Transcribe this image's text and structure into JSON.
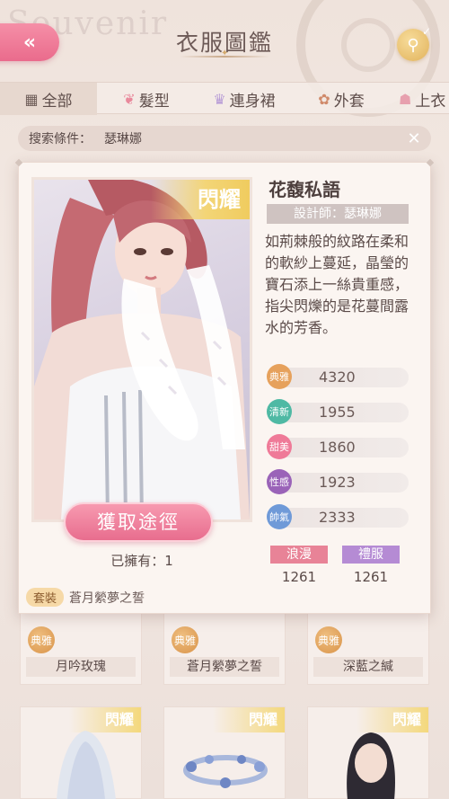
{
  "header": {
    "title": "衣服圖鑑",
    "back_icon": "double-chevron-left-icon",
    "search_icon": "magnifier-icon"
  },
  "background": {
    "ghost_text": "Souvenir"
  },
  "tabs": [
    {
      "label": "全部",
      "icon": "grid-icon",
      "active": true
    },
    {
      "label": "髮型",
      "icon": "hair-icon",
      "active": false
    },
    {
      "label": "連身裙",
      "icon": "dress-icon",
      "active": false
    },
    {
      "label": "外套",
      "icon": "coat-icon",
      "active": false
    },
    {
      "label": "上衣",
      "icon": "shirt-icon",
      "active": false
    }
  ],
  "filter": {
    "label": "搜索條件：",
    "value": "瑟琳娜"
  },
  "detail": {
    "name": "花馥私語",
    "designer": "設計師：瑟琳娜",
    "description": "如荊棘般的紋路在柔和的軟紗上蔓延，晶瑩的寶石添上一絲貴重感，指尖閃爍的是花蔓間露水的芳香。",
    "flash_tag": "閃耀",
    "acquire_label": "獲取途徑",
    "owned_text": "已擁有：1",
    "set_tag": "套裝",
    "set_name": "蒼月縈夢之誓",
    "stats": [
      {
        "label": "典雅",
        "value": "4320",
        "color": "#e6a15c"
      },
      {
        "label": "清新",
        "value": "1955",
        "color": "#4fb9a4"
      },
      {
        "label": "甜美",
        "value": "1860",
        "color": "#ef7a98"
      },
      {
        "label": "性感",
        "value": "1923",
        "color": "#9a63b8"
      },
      {
        "label": "帥氣",
        "value": "2333",
        "color": "#6f9ad8"
      }
    ],
    "tags": [
      {
        "label": "浪漫",
        "value": "1261",
        "color": "#e88397"
      },
      {
        "label": "禮服",
        "value": "1261",
        "color": "#b58bd4"
      }
    ]
  },
  "grid": [
    {
      "badge": "典雅",
      "name": "月吟玫瑰",
      "flash": ""
    },
    {
      "badge": "典雅",
      "name": "蒼月縈夢之誓",
      "flash": ""
    },
    {
      "badge": "典雅",
      "name": "深藍之緘",
      "flash": ""
    },
    {
      "badge": "",
      "name": "",
      "flash": "閃耀"
    },
    {
      "badge": "",
      "name": "",
      "flash": "閃耀"
    },
    {
      "badge": "",
      "name": "",
      "flash": "閃耀"
    }
  ]
}
